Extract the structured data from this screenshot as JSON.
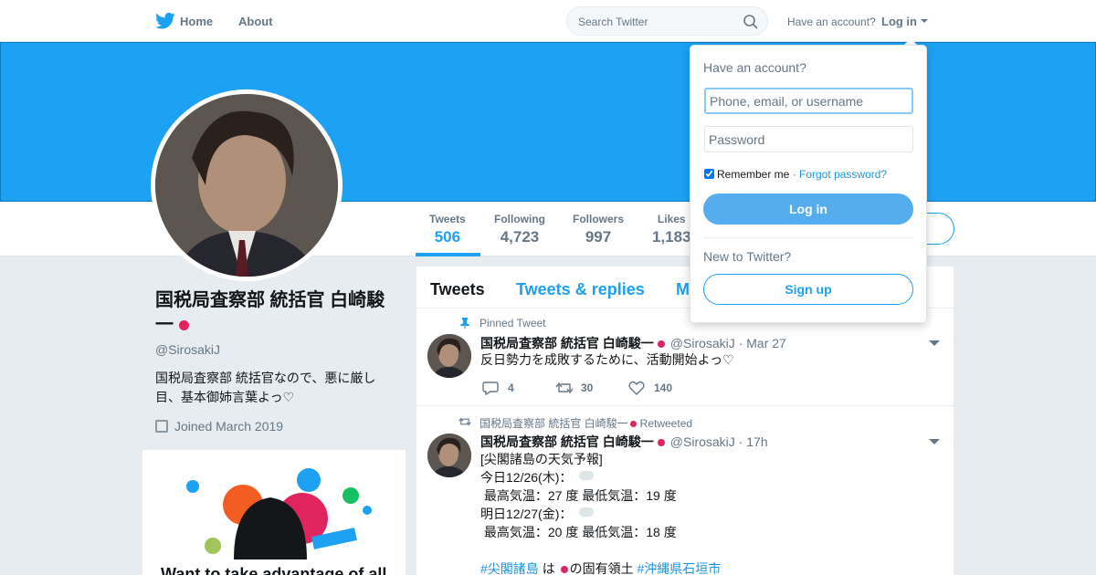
{
  "nav": {
    "home_label": "Home",
    "about_label": "About",
    "search_placeholder": "Search Twitter",
    "have_account_text": "Have an account?",
    "login_label": "Log in"
  },
  "colors": {
    "brand": "#1da1f2",
    "banner": "#1da1f2",
    "login_button": "#55acee",
    "link": "#1b95e0"
  },
  "profile": {
    "name": "国税局査察部 統括官 白崎駿一",
    "handle": "@SirosakiJ",
    "bio": "国税局査察部 統括官なので、悪に厳し目、基本御姉言葉よっ♡",
    "joined": "Joined March 2019"
  },
  "stats": [
    {
      "label": "Tweets",
      "value": "506"
    },
    {
      "label": "Following",
      "value": "4,723"
    },
    {
      "label": "Followers",
      "value": "997"
    },
    {
      "label": "Likes",
      "value": "1,183"
    }
  ],
  "promo": {
    "title": "Want to take advantage of all"
  },
  "tabs": [
    {
      "label": "Tweets"
    },
    {
      "label": "Tweets & replies"
    },
    {
      "label": "M"
    }
  ],
  "tweets": [
    {
      "context": "Pinned Tweet",
      "author": "国税局査察部 統括官 白崎駿一",
      "handle": "@SirosakiJ",
      "time": "Mar 27",
      "text": "反日勢力を成敗するために、活動開始よっ♡",
      "replies": "4",
      "retweets": "30",
      "likes": "140"
    },
    {
      "context_name": "国税局査察部 統括官 白崎駿一",
      "context": "Retweeted",
      "author": "国税局査察部 統括官 白崎駿一",
      "handle": "@SirosakiJ",
      "time": "17h",
      "lines": [
        "[尖閣諸島の天気予報]",
        "今日12/26(木)：",
        " 最高気温：27 度 最低気温：19 度",
        "明日12/27(金)：",
        " 最高気温：20 度 最低気温：18 度"
      ],
      "hashtag1": "#尖閣諸島",
      "mid_text": "は",
      "mid_text2": "の固有領土",
      "hashtag2": "#沖縄県石垣市"
    }
  ],
  "login_dropdown": {
    "title": "Have an account?",
    "username_placeholder": "Phone, email, or username",
    "password_placeholder": "Password",
    "remember_label": "Remember me",
    "separator": "·",
    "forgot_label": "Forgot password?",
    "login_button": "Log in",
    "new_text": "New to Twitter?",
    "signup_button": "Sign up"
  }
}
